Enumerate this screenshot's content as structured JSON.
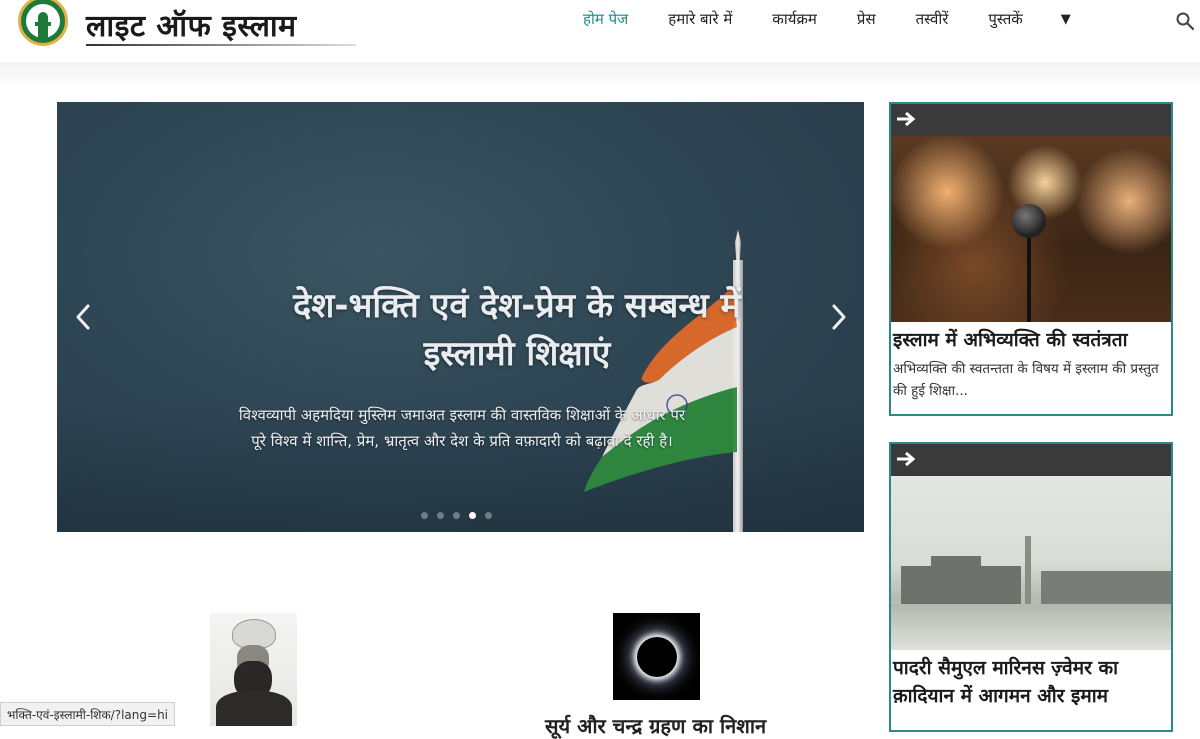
{
  "header": {
    "site_title": "लाइट ऑफ इस्लाम",
    "nav": [
      {
        "label": "होम पेज",
        "active": true
      },
      {
        "label": "हमारे बारे में",
        "active": false
      },
      {
        "label": "कार्यक्रम",
        "active": false
      },
      {
        "label": "प्रेस",
        "active": false
      },
      {
        "label": "तस्वीरें",
        "active": false
      },
      {
        "label": "पुस्तकें",
        "active": false
      }
    ],
    "more_icon": "caret-down-icon",
    "search_icon": "search-icon"
  },
  "slider": {
    "title": "देश-भक्ति एवं देश-प्रेम के सम्बन्ध में इस्लामी शिक्षाएं",
    "text": "विश्वव्यापी अहमदिया मुस्लिम जमाअत इस्लाम की वास्तविक शिक्षाओं के आधार पर पूरे विश्व में शान्ति, प्रेम, भ्रातृत्व और देश के प्रति वफ़ादारी को बढ़ावा दे रही है।",
    "slide_count": 5,
    "active_slide": 4
  },
  "cards": [
    {
      "title": "इस्लाम में अभिव्यक्ति की स्वतंत्रता",
      "description": "अभिव्यक्ति की स्वतन्तता के विषय में इस्लाम की प्रस्तुत की हुई शिक्षा..."
    },
    {
      "title": "पादरी सैमुएल मारिनस ज़्वेमर का क़ादियान में आगमन और इमाम",
      "description": ""
    }
  ],
  "lower": {
    "heading": "सूर्य और चन्द्र ग्रहण का निशान"
  },
  "status_bar": {
    "url": "भक्ति-एवं-इस्लामी-शिक/?lang=hi"
  },
  "colors": {
    "accent": "#1e8b8b",
    "card_border": "#2c8a86",
    "card_bar": "#3a3a3a"
  }
}
